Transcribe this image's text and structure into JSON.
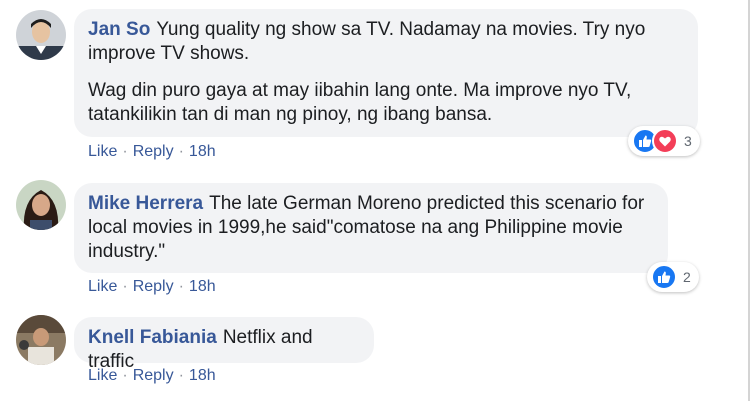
{
  "comments": [
    {
      "author": "Jan So",
      "paragraphs": [
        "Yung quality ng show sa TV. Nadamay na movies. Try nyo improve TV shows.",
        "Wag din puro gaya at may iibahin lang onte. Ma improve nyo TV, tatankilikin tan di man ng pinoy, ng ibang bansa."
      ],
      "actions": {
        "like": "Like",
        "reply": "Reply",
        "separator": "·",
        "time": "18h"
      },
      "reactions": {
        "icons": [
          "like-icon",
          "love-icon"
        ],
        "count": "3"
      }
    },
    {
      "author": "Mike Herrera",
      "paragraphs": [
        "The late German Moreno predicted this scenario for local movies in 1999,he said\"comatose na ang Philippine movie industry.\""
      ],
      "actions": {
        "like": "Like",
        "reply": "Reply",
        "separator": "·",
        "time": "18h"
      },
      "reactions": {
        "icons": [
          "like-icon"
        ],
        "count": "2"
      }
    },
    {
      "author": "Knell Fabiania",
      "paragraphs": [
        "Netflix and traffic"
      ],
      "actions": {
        "like": "Like",
        "reply": "Reply",
        "separator": "·",
        "time": "18h"
      }
    }
  ],
  "colors": {
    "author_link": "#385898",
    "bubble_bg": "#f2f3f5",
    "like_blue": "#1877f2",
    "love_red": "#f33e58"
  }
}
